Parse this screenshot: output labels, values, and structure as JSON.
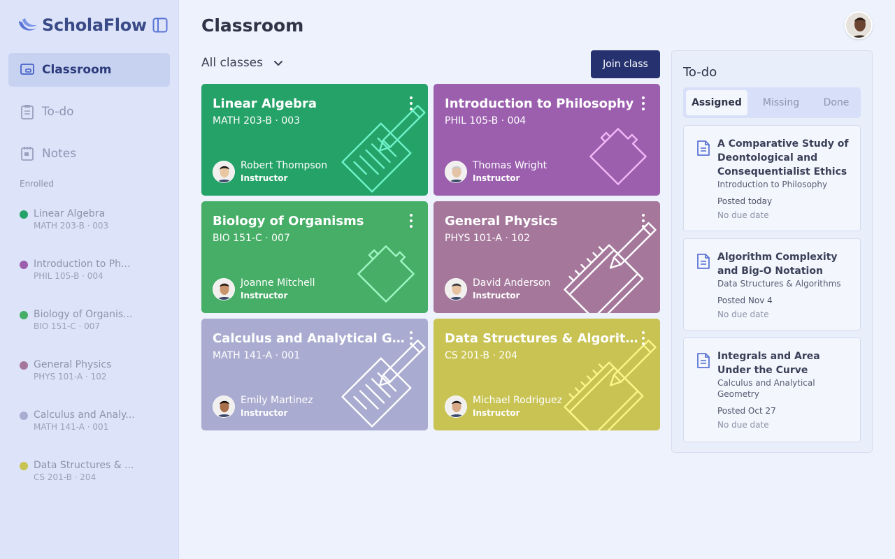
{
  "app": {
    "name": "ScholaFlow"
  },
  "sidebar": {
    "nav": [
      {
        "label": "Classroom",
        "icon": "classroom-icon",
        "active": true
      },
      {
        "label": "To-do",
        "icon": "clipboard-icon",
        "active": false
      },
      {
        "label": "Notes",
        "icon": "notes-icon",
        "active": false
      }
    ],
    "enrolled_title": "Enrolled",
    "enrolled": [
      {
        "name": "Linear Algebra",
        "code": "MATH 203-B · 003",
        "color": "#25a268"
      },
      {
        "name": "Introduction to Ph...",
        "code": "PHIL 105-B · 004",
        "color": "#9b5fae"
      },
      {
        "name": "Biology of Organis...",
        "code": "BIO 151-C · 007",
        "color": "#47ae67"
      },
      {
        "name": "General Physics",
        "code": "PHYS 101-A · 102",
        "color": "#a5789b"
      },
      {
        "name": "Calculus and Analy...",
        "code": "MATH 141-A · 001",
        "color": "#a9acd0"
      },
      {
        "name": "Data Structures & ...",
        "code": "CS 201-B · 204",
        "color": "#c8c353"
      }
    ]
  },
  "header": {
    "title": "Classroom"
  },
  "filter": {
    "label": "All classes"
  },
  "join_label": "Join class",
  "cards": [
    {
      "title": "Linear Algebra",
      "code": "MATH 203-B · 003",
      "instructor": "Robert Thompson",
      "role": "Instructor",
      "bg": "#25a268",
      "deco_color": "#6ff2c9",
      "deco": "notebook-icon"
    },
    {
      "title": "Introduction to Philosophy",
      "code": "PHIL 105-B · 004",
      "instructor": "Thomas Wright",
      "role": "Instructor",
      "bg": "#9b5fae",
      "deco_color": "#f0b8f6",
      "deco": "puzzle-icon"
    },
    {
      "title": "Biology of Organisms",
      "code": "BIO 151-C · 007",
      "instructor": "Joanne Mitchell",
      "role": "Instructor",
      "bg": "#47ae67",
      "deco_color": "#9ff6c3",
      "deco": "puzzle-icon"
    },
    {
      "title": "General Physics",
      "code": "PHYS 101-A · 102",
      "instructor": "David Anderson",
      "role": "Instructor",
      "bg": "#a5789b",
      "deco_color": "#ffffff",
      "deco": "ruler-icon"
    },
    {
      "title": "Calculus and Analytical Geom...",
      "code": "MATH 141-A · 001",
      "instructor": "Emily Martinez",
      "role": "Instructor",
      "bg": "#a9acd0",
      "deco_color": "#ffffff",
      "deco": "notebook-icon"
    },
    {
      "title": "Data Structures & Algorithms",
      "code": "CS 201-B · 204",
      "instructor": "Michael Rodriguez",
      "role": "Instructor",
      "bg": "#c8c353",
      "deco_color": "#fbf58a",
      "deco": "ruler-icon"
    }
  ],
  "todo": {
    "title": "To-do",
    "tabs": [
      "Assigned",
      "Missing",
      "Done"
    ],
    "items": [
      {
        "title": "A Comparative Study of Deontological and Consequentialist Ethics",
        "class": "Introduction to Philosophy",
        "posted": "Posted today",
        "due": "No due date"
      },
      {
        "title": "Algorithm Complexity and Big-O Notation",
        "class": "Data Structures & Algorithms",
        "posted": "Posted Nov 4",
        "due": "No due date"
      },
      {
        "title": "Integrals and Area Under the Curve",
        "class": "Calculus and Analytical Geometry",
        "posted": "Posted Oct 27",
        "due": "No due date"
      }
    ]
  },
  "colors": {
    "accent": "#25326f",
    "sidebar_bg": "#dde4fa",
    "page_bg": "#eef2fc"
  }
}
